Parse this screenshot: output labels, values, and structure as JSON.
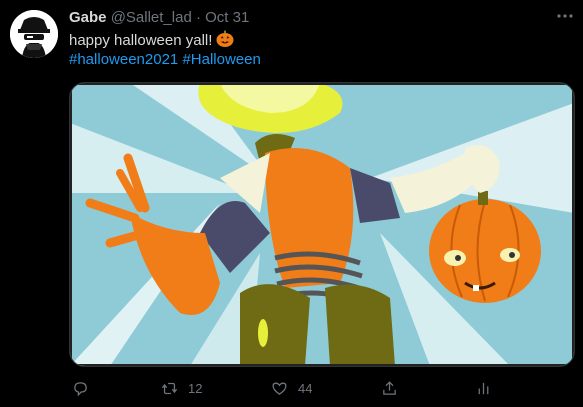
{
  "tweet": {
    "author_name": "Gabe",
    "author_handle": "@Sallet_lad",
    "separator": "·",
    "date": "Oct 31",
    "text": "happy halloween yall!",
    "emoji": "jack-o-lantern",
    "hashtags": [
      "#halloween2021",
      "#Halloween"
    ]
  },
  "actions": {
    "reply": {
      "icon": "reply-icon",
      "count": ""
    },
    "retweet": {
      "icon": "retweet-icon",
      "count": "12"
    },
    "like": {
      "icon": "heart-icon",
      "count": "44"
    },
    "share": {
      "icon": "share-icon",
      "count": ""
    },
    "analytics": {
      "icon": "analytics-icon",
      "count": ""
    }
  },
  "colors": {
    "background": "#000000",
    "text": "#d9d9d9",
    "muted": "#6e767d",
    "link": "#1d9bf0",
    "art_sky": "#8ecbd6",
    "art_orange": "#f07d18",
    "art_olive": "#6f6a14",
    "art_yellow": "#e6f03a",
    "art_purple": "#4a4a6a"
  }
}
